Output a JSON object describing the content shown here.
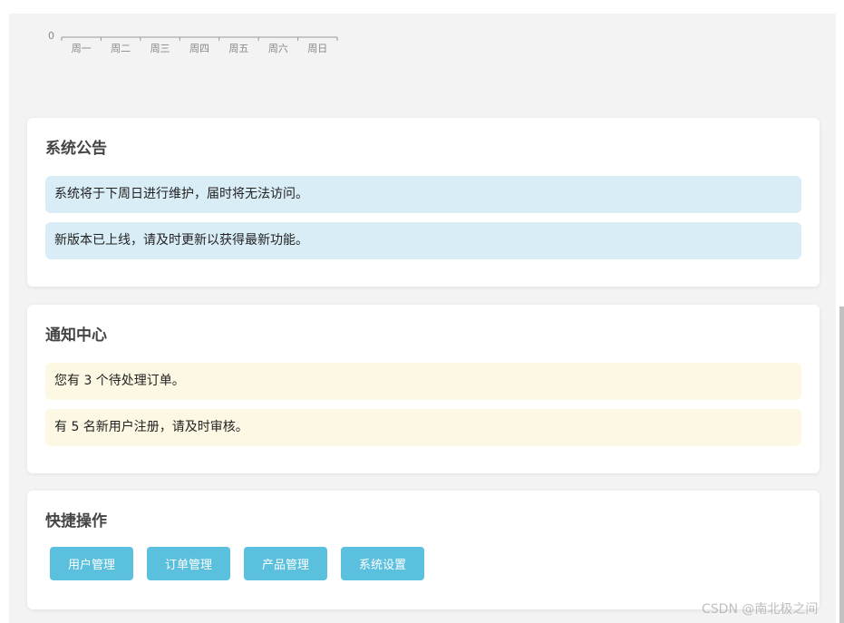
{
  "chart_data": {
    "type": "bar",
    "categories": [
      "周一",
      "周二",
      "周三",
      "周四",
      "周五",
      "周六",
      "周日"
    ],
    "y_tick_visible": "0"
  },
  "announcements": {
    "title": "系统公告",
    "items": [
      "系统将于下周日进行维护，届时将无法访问。",
      "新版本已上线，请及时更新以获得最新功能。"
    ]
  },
  "notifications": {
    "title": "通知中心",
    "items": [
      "您有 3 个待处理订单。",
      "有 5 名新用户注册，请及时审核。"
    ]
  },
  "quick_actions": {
    "title": "快捷操作",
    "buttons": [
      "用户管理",
      "订单管理",
      "产品管理",
      "系统设置"
    ]
  },
  "watermark": "CSDN @南北极之间",
  "colors": {
    "info_bg": "#d9edf7",
    "warn_bg": "#fcf8e3",
    "button_bg": "#5bc0de"
  }
}
